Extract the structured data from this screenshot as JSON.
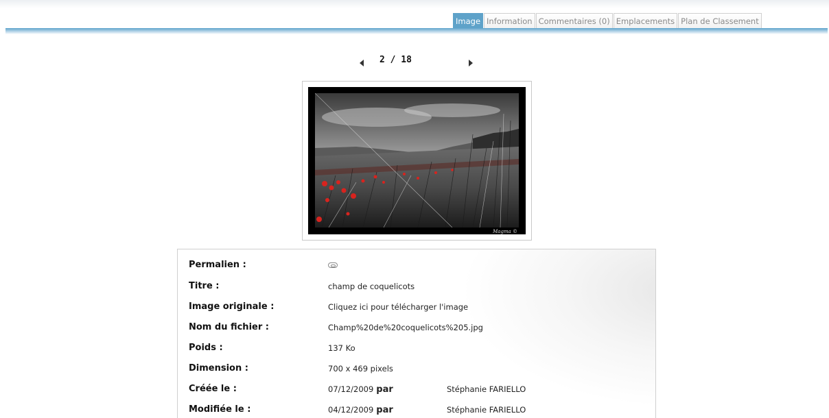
{
  "tabs": [
    {
      "label": "Image",
      "active": true
    },
    {
      "label": "Information",
      "active": false
    },
    {
      "label": "Commentaires (0)",
      "active": false
    },
    {
      "label": "Emplacements",
      "active": false
    },
    {
      "label": "Plan de Classement",
      "active": false
    }
  ],
  "pager": {
    "current": "2 / 18",
    "prev_icon": "triangle-left-icon",
    "next_icon": "triangle-right-icon"
  },
  "photo": {
    "watermark": "Magma ©"
  },
  "info": {
    "permalien": {
      "label": "Permalien :",
      "icon": "link-icon"
    },
    "titre": {
      "label": "Titre :",
      "value": "champ de coquelicots"
    },
    "image_originale": {
      "label": "Image originale :",
      "value": "Cliquez ici pour télécharger l'image"
    },
    "nom_fichier": {
      "label": "Nom du fichier :",
      "value": "Champ%20de%20coquelicots%205.jpg"
    },
    "poids": {
      "label": "Poids :",
      "value": "137 Ko"
    },
    "dimension": {
      "label": "Dimension :",
      "value": "700 x 469 pixels"
    },
    "creee": {
      "label": "Créée le :",
      "date": "07/12/2009",
      "par": "par",
      "author": "Stéphanie FARIELLO"
    },
    "modifiee": {
      "label": "Modifiée le :",
      "date": "04/12/2009",
      "par": "par",
      "author": "Stéphanie FARIELLO"
    }
  },
  "colors": {
    "accent": "#5ea2c9",
    "poppy": "#d8231e"
  }
}
